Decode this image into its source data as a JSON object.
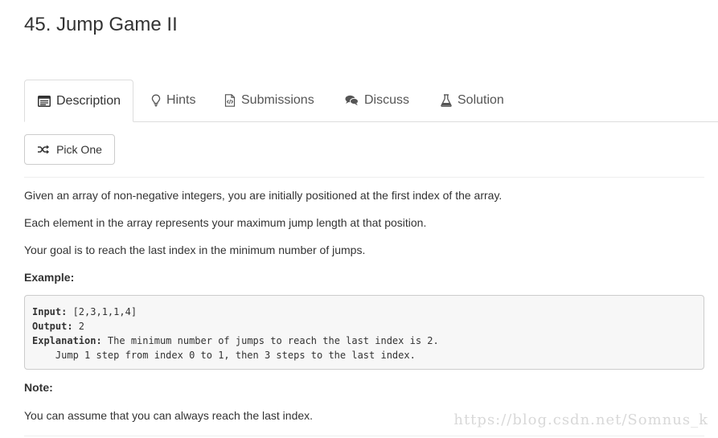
{
  "problem": {
    "title": "45. Jump Game II"
  },
  "tabs": [
    {
      "label": "Description",
      "icon": "description-icon",
      "active": true
    },
    {
      "label": "Hints",
      "icon": "lightbulb-icon",
      "active": false
    },
    {
      "label": "Submissions",
      "icon": "code-file-icon",
      "active": false
    },
    {
      "label": "Discuss",
      "icon": "comments-icon",
      "active": false
    },
    {
      "label": "Solution",
      "icon": "flask-icon",
      "active": false
    }
  ],
  "toolbar": {
    "pick_one_label": "Pick One",
    "pick_one_icon": "shuffle-icon"
  },
  "description": {
    "para1": "Given an array of non-negative integers, you are initially positioned at the first index of the array.",
    "para2": "Each element in the array represents your maximum jump length at that position.",
    "para3": "Your goal is to reach the last index in the minimum number of jumps.",
    "example_heading": "Example:",
    "example": {
      "input_key": "Input:",
      "input_value": " [2,3,1,1,4]",
      "output_key": "Output:",
      "output_value": " 2",
      "explanation_key": "Explanation:",
      "explanation_value": " The minimum number of jumps to reach the last index is 2.",
      "explanation_cont": "    Jump 1 step from index 0 to 1, then 3 steps to the last index."
    },
    "note_heading": "Note:",
    "note_text": "You can assume that you can always reach the last index."
  },
  "watermark": "https://blog.csdn.net/Somnus_k",
  "colors": {
    "text": "#333333",
    "tab_text": "#555555",
    "border": "#dddddd",
    "code_bg": "#f7f7f7"
  }
}
